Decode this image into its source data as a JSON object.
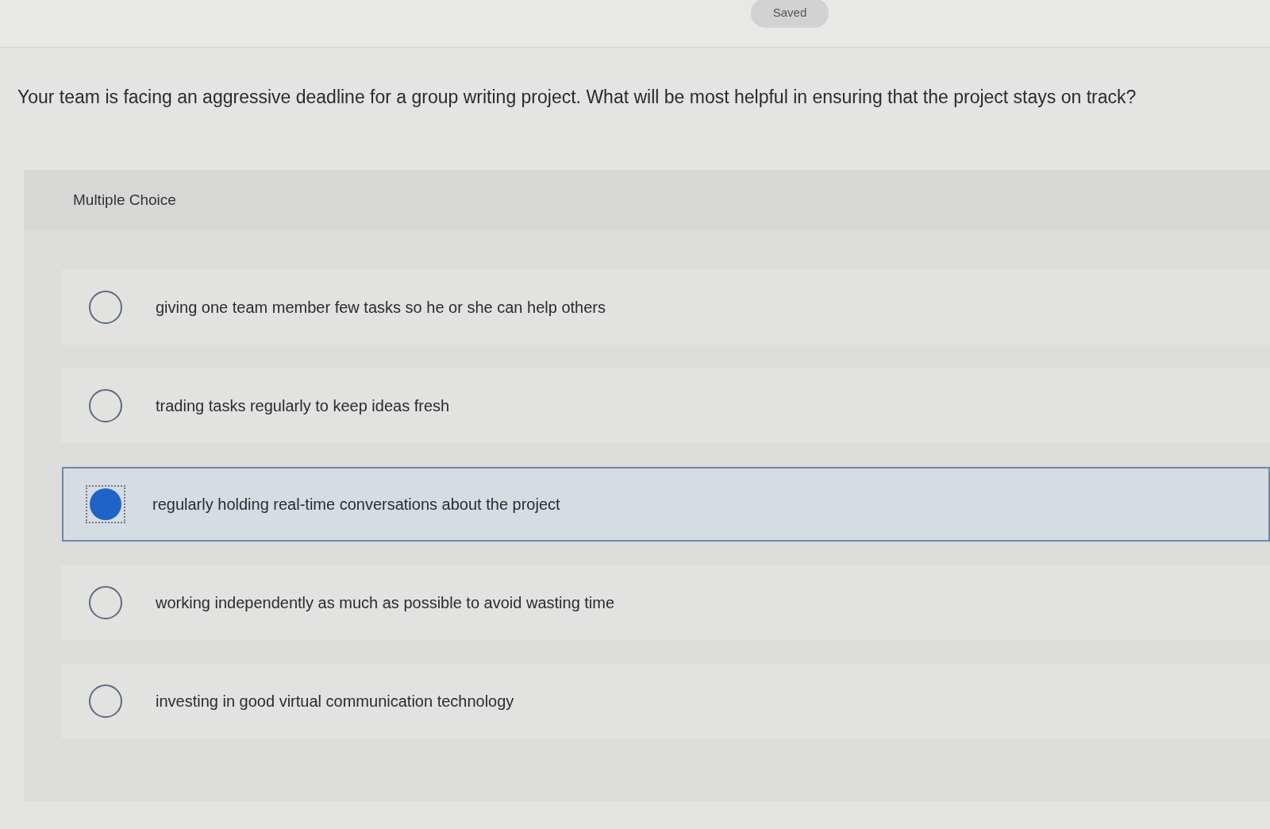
{
  "status": {
    "label": "Saved"
  },
  "question": "Your team is facing an aggressive deadline for a group writing project. What will be most helpful in ensuring that the project stays on track?",
  "panel": {
    "title": "Multiple Choice",
    "options": [
      {
        "label": "giving one team member few tasks so he or she can help others",
        "selected": false
      },
      {
        "label": "trading tasks regularly to keep ideas fresh",
        "selected": false
      },
      {
        "label": "regularly holding real-time conversations about the project",
        "selected": true
      },
      {
        "label": "working independently as much as possible to avoid wasting time",
        "selected": false
      },
      {
        "label": "investing in good virtual communication technology",
        "selected": false
      }
    ]
  }
}
